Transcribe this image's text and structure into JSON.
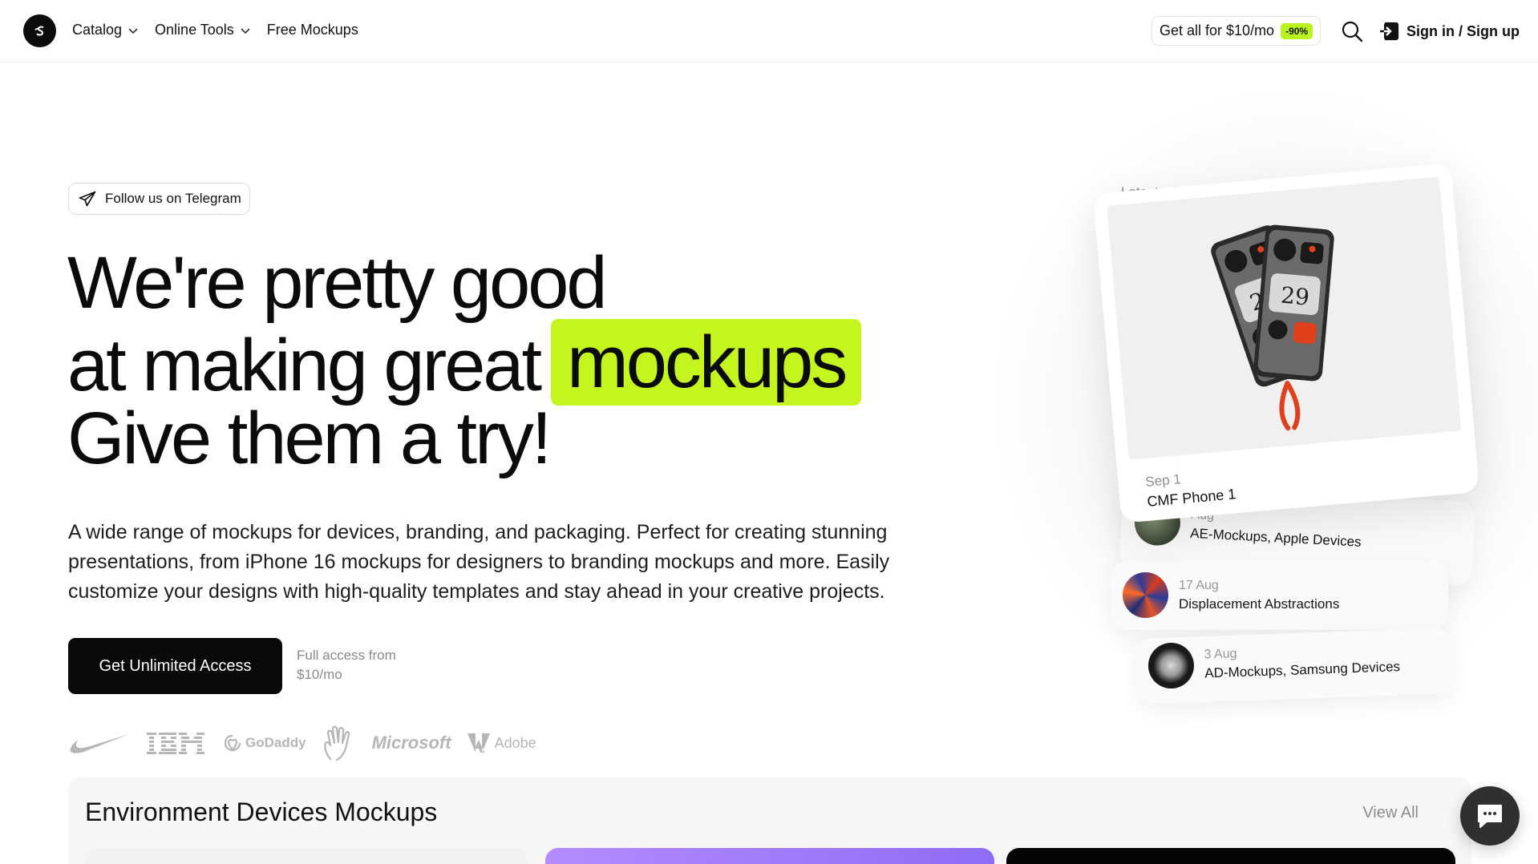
{
  "header": {
    "logo_icon": "logo-mark-icon",
    "nav": [
      {
        "label": "Catalog",
        "has_dropdown": true
      },
      {
        "label": "Online Tools",
        "has_dropdown": true
      },
      {
        "label": "Free Mockups",
        "has_dropdown": false
      }
    ],
    "promo_label": "Get all for $10/mo",
    "promo_badge": "-90%",
    "signin_label": "Sign in / Sign up"
  },
  "hero": {
    "telegram_label": "Follow us on Telegram",
    "headline_line1": "We're pretty good",
    "headline_line2_prefix": "at making great",
    "headline_highlight": "mockups",
    "headline_line3": "Give them a try!",
    "description": "A wide range of mockups for devices, branding, and packaging. Perfect for creating stunning presentations, from iPhone 16 mockups for designers to branding mockups and more. Easily customize your designs with high-quality templates and stay ahead in your creative projects.",
    "cta_label": "Get Unlimited Access",
    "cta_note": "Full access from $10/mo",
    "brands": [
      "Nike",
      "IBM",
      "GoDaddy",
      "Hand",
      "Microsoft",
      "Adobe"
    ],
    "brand_godaddy": "GoDaddy",
    "brand_microsoft": "Microsoft",
    "brand_adobe": "Adobe"
  },
  "releases": {
    "label": "Latest releases",
    "featured": {
      "date": "Sep 1",
      "name": "CMF Phone 1",
      "screen_number": "29"
    },
    "items": [
      {
        "date": "Aug",
        "name": "AE-Mockups, Apple Devices"
      },
      {
        "date": "17 Aug",
        "name": "Displacement Abstractions"
      },
      {
        "date": "3 Aug",
        "name": "AD-Mockups, Samsung Devices"
      }
    ]
  },
  "section": {
    "title": "Environment Devices Mockups",
    "view_all": "View All"
  },
  "colors": {
    "accent": "#c4f51f",
    "badge": "#b8f21f",
    "dark": "#0a0a0a",
    "chat": "#303030"
  }
}
